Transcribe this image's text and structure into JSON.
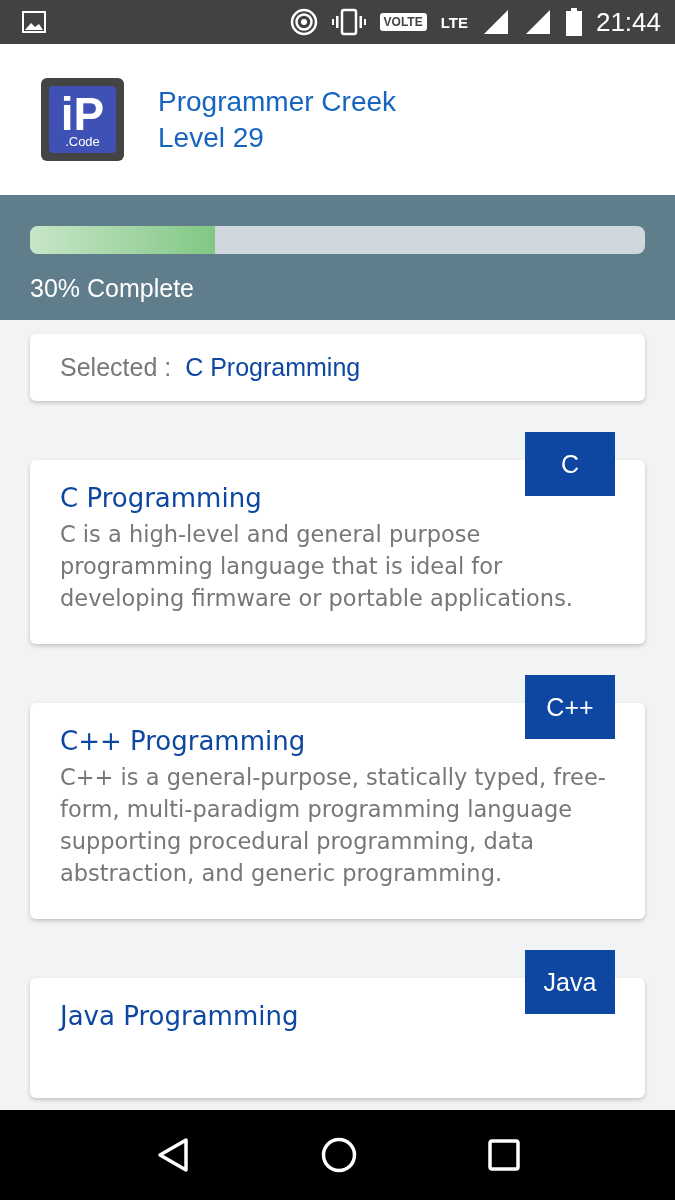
{
  "status_bar": {
    "volte": "VOLTE",
    "lte": "LTE",
    "time": "21:44"
  },
  "header": {
    "logo_mark": "iP",
    "logo_text": ".Code",
    "title": "Programmer Creek",
    "level": "Level 29"
  },
  "progress": {
    "level": 0.3,
    "label": "30% Complete"
  },
  "selection": {
    "label": "Selected :",
    "value": "C Programming"
  },
  "courses": [
    {
      "badge": "C",
      "title": "C Programming",
      "description": "C is a high-level and general purpose programming language that is ideal for developing firmware or portable applications."
    },
    {
      "badge": "C++",
      "title": "C++ Programming",
      "description": "C++ is a general-purpose, statically typed, free-form, multi-paradigm programming language supporting procedural programming, data abstraction, and generic programming."
    },
    {
      "badge": "Java",
      "title": "Java Programming"
    }
  ]
}
